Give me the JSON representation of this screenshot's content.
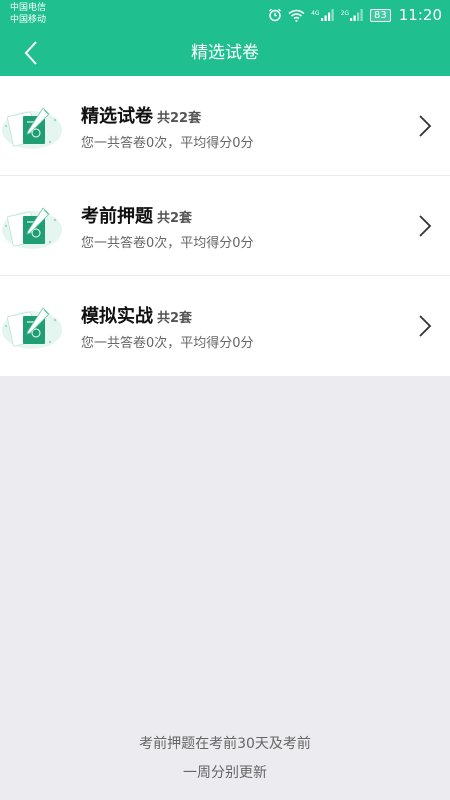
{
  "status_bar": {
    "carrier_1": "中国电信",
    "carrier_2": "中国移动",
    "net_1": "4G",
    "net_2": "2G",
    "battery": "83",
    "time": "11:20"
  },
  "nav": {
    "title": "精选试卷"
  },
  "items": [
    {
      "title": "精选试卷",
      "count": "共22套",
      "subtitle": "您一共答卷0次，平均得分0分"
    },
    {
      "title": "考前押题",
      "count": "共2套",
      "subtitle": "您一共答卷0次，平均得分0分"
    },
    {
      "title": "模拟实战",
      "count": "共2套",
      "subtitle": "您一共答卷0次，平均得分0分"
    }
  ],
  "footer": {
    "line_1": "考前押题在考前30天及考前",
    "line_2": "一周分别更新"
  },
  "colors": {
    "brand": "#1fbf8f",
    "background": "#ebebf0"
  }
}
